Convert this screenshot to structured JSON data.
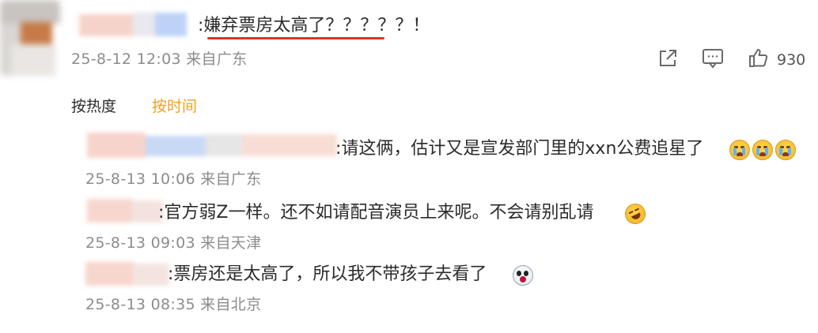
{
  "main_comment": {
    "text": ":嫌弃票房太高了？？？？？！",
    "meta": "25-8-12 12:03 来自广东",
    "like_count": "930",
    "action_icons": [
      "share-icon",
      "comment-icon",
      "like-icon"
    ],
    "highlight_color": "#e0332b"
  },
  "sort_tabs": [
    {
      "label": "按热度",
      "active": false
    },
    {
      "label": "按时间",
      "active": true
    }
  ],
  "replies": [
    {
      "text": ":请这俩，估计又是宣发部门里的xxn公费追星了",
      "emoji": [
        "crying-emoji",
        "crying-emoji",
        "crying-emoji"
      ],
      "meta": "25-8-13 10:06 来自广东"
    },
    {
      "text": ":官方弱Z一样。还不如请配音演员上来呢。不会请别乱请",
      "emoji": [
        "laughing-emoji"
      ],
      "meta": "25-8-13 09:03 来自天津"
    },
    {
      "text": ":票房还是太高了，所以我不带孩子去看了",
      "emoji": [
        "scared-emoji"
      ],
      "meta": "25-8-13 08:35 来自北京"
    }
  ],
  "colors": {
    "accent_active_tab": "#f0a020",
    "meta_text": "#8c8c8c",
    "body_text": "#2b2b2b"
  }
}
